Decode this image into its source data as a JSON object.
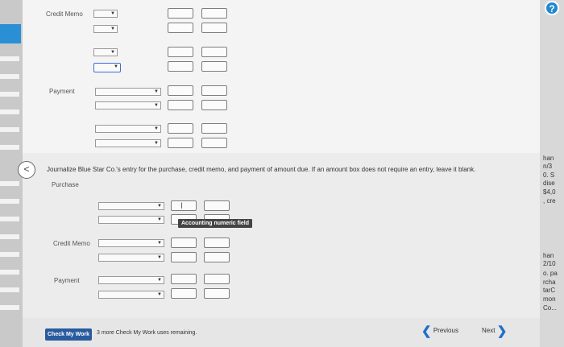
{
  "top_section": {
    "rows": [
      {
        "label": "Credit Memo",
        "label_y": 13,
        "label_x": 57
      },
      {
        "label": "Payment",
        "label_y": 109,
        "label_x": 61
      }
    ]
  },
  "instructions": "Journalize Blue Star Co.'s entry for the purchase, credit memo, and payment of amount due. If an amount box does not require an entry, leave it blank.",
  "bottom_section": {
    "purchase_label": "Purchase",
    "credit_memo_label": "Credit Memo",
    "payment_label": "Payment",
    "tooltip": "Accounting numeric field"
  },
  "right_panel": [
    "han",
    "n/3",
    "0. S",
    "dise",
    "$4,0",
    ", cre",
    "",
    "",
    "",
    "",
    "han",
    "2/10",
    "o. pa",
    "rcha",
    "tarC",
    "mon",
    "Co..."
  ],
  "help_glyph": "?",
  "footer": {
    "check_label": "Check My Work",
    "remaining": "3 more Check My Work uses remaining.",
    "previous": "Previous",
    "next": "Next"
  },
  "colors": {
    "accent": "#1e6fc9",
    "check_button": "#2a5b9e",
    "help": "#1e88d0"
  }
}
